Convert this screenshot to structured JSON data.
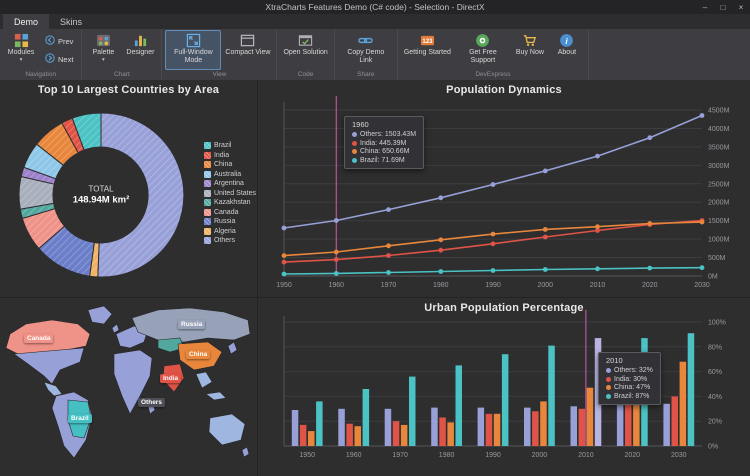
{
  "window": {
    "title": "XtraCharts Features Demo (C# code) - Selection - DirectX",
    "controls": [
      {
        "name": "minimize-button",
        "glyph": "–"
      },
      {
        "name": "maximize-button",
        "glyph": "□"
      },
      {
        "name": "close-button",
        "glyph": "×"
      }
    ]
  },
  "tabs": [
    {
      "label": "Demo",
      "active": true
    },
    {
      "label": "Skins",
      "active": false
    }
  ],
  "ribbon": {
    "groups": [
      {
        "name": "Navigation",
        "items": [
          {
            "kind": "big",
            "label": "Modules",
            "icon": "modules-icon",
            "caret": true
          },
          {
            "kind": "stack",
            "items": [
              {
                "label": "Prev",
                "icon": "prev-icon"
              },
              {
                "label": "Next",
                "icon": "next-icon"
              }
            ]
          }
        ]
      },
      {
        "name": "Chart",
        "items": [
          {
            "kind": "big",
            "label": "Palette",
            "icon": "palette-icon",
            "caret": true
          },
          {
            "kind": "big",
            "label": "Designer",
            "icon": "designer-icon"
          }
        ]
      },
      {
        "name": "View",
        "items": [
          {
            "kind": "big",
            "label": "Full-Window Mode",
            "icon": "full-window-icon",
            "selected": true
          },
          {
            "kind": "big",
            "label": "Compact View",
            "icon": "compact-view-icon"
          }
        ]
      },
      {
        "name": "Code",
        "items": [
          {
            "kind": "big",
            "label": "Open Solution",
            "icon": "open-solution-icon"
          }
        ]
      },
      {
        "name": "Share",
        "items": [
          {
            "kind": "big",
            "label": "Copy Demo Link",
            "icon": "copy-link-icon"
          }
        ]
      },
      {
        "name": "DevExpress",
        "items": [
          {
            "kind": "big",
            "label": "Getting Started",
            "icon": "getting-started-icon"
          },
          {
            "kind": "big",
            "label": "Get Free Support",
            "icon": "support-icon"
          },
          {
            "kind": "big",
            "label": "Buy Now",
            "icon": "buy-now-icon"
          },
          {
            "kind": "big",
            "label": "About",
            "icon": "about-icon"
          }
        ]
      }
    ]
  },
  "chart_data": [
    {
      "id": "area-donut",
      "type": "pie",
      "title": "Top 10 Largest Countries by Area",
      "center_label": {
        "line1": "TOTAL",
        "line2": "148.94M km²"
      },
      "unit": "M km²",
      "slices": [
        {
          "name": "Brazil",
          "value": 8.51,
          "color": "#4bc2c4"
        },
        {
          "name": "India",
          "value": 3.29,
          "color": "#e05347"
        },
        {
          "name": "China",
          "value": 9.6,
          "color": "#e8873c"
        },
        {
          "name": "Australia",
          "value": 7.69,
          "color": "#8fc7e8"
        },
        {
          "name": "Argentina",
          "value": 2.78,
          "color": "#9b82cc"
        },
        {
          "name": "United States",
          "value": 9.52,
          "color": "#a7aebc"
        },
        {
          "name": "Kazakhstan",
          "value": 2.72,
          "color": "#52a89e"
        },
        {
          "name": "Canada",
          "value": 9.98,
          "color": "#ef9288"
        },
        {
          "name": "Russia",
          "value": 17.1,
          "color": "#6b7ec9"
        },
        {
          "name": "Algeria",
          "value": 2.38,
          "color": "#f0b264"
        },
        {
          "name": "Others",
          "value": 75.37,
          "color": "#98a0d8"
        }
      ]
    },
    {
      "id": "population",
      "type": "line",
      "title": "Population Dynamics",
      "x": [
        1950,
        1960,
        1970,
        1980,
        1990,
        2000,
        2010,
        2020,
        2030
      ],
      "ylim": [
        0,
        4500
      ],
      "ytick_step": 500,
      "ytick_suffix": "M",
      "series": [
        {
          "name": "Others",
          "color": "#98a0d8",
          "values": [
            1300,
            1503.43,
            1800,
            2120,
            2480,
            2850,
            3250,
            3750,
            4350
          ]
        },
        {
          "name": "India",
          "color": "#e05347",
          "values": [
            376,
            445.39,
            555,
            699,
            873,
            1057,
            1234,
            1396,
            1504
          ]
        },
        {
          "name": "China",
          "color": "#e8873c",
          "values": [
            554,
            650.66,
            820,
            981,
            1135,
            1262,
            1337,
            1424,
            1460
          ]
        },
        {
          "name": "Brazil",
          "color": "#4bc2c4",
          "values": [
            54,
            71.69,
            96,
            121,
            149,
            175,
            196,
            214,
            225
          ]
        }
      ],
      "crosshair_x": 1960,
      "crosshair_color": "#d45cb1",
      "tooltip": {
        "header": "1960",
        "rows": [
          {
            "label": "Others",
            "value": "1503.43M",
            "color": "#98a0d8"
          },
          {
            "label": "India",
            "value": "445.39M",
            "color": "#e05347"
          },
          {
            "label": "China",
            "value": "650.66M",
            "color": "#e8873c"
          },
          {
            "label": "Brazil",
            "value": "71.69M",
            "color": "#4bc2c4"
          }
        ]
      }
    },
    {
      "id": "world-map",
      "type": "map",
      "regions": [
        {
          "name": "Canada",
          "color": "#ef9288"
        },
        {
          "name": "Russia",
          "color": "#97a2b8"
        },
        {
          "name": "China",
          "color": "#e8873c"
        },
        {
          "name": "India",
          "color": "#e05347"
        },
        {
          "name": "Others",
          "color": "#4e4e56"
        },
        {
          "name": "Brazil",
          "color": "#45bfc1"
        }
      ]
    },
    {
      "id": "urban",
      "type": "bar",
      "title": "Urban Population Percentage",
      "x": [
        1950,
        1960,
        1970,
        1980,
        1990,
        2000,
        2010,
        2020,
        2030
      ],
      "ylim": [
        0,
        100
      ],
      "ytick_step": 20,
      "ytick_suffix": "%",
      "series": [
        {
          "name": "Others",
          "color": "#98a0d8",
          "values": [
            29,
            30,
            30,
            31,
            31,
            31,
            32,
            33,
            34
          ]
        },
        {
          "name": "India",
          "color": "#e05347",
          "values": [
            17,
            18,
            20,
            23,
            26,
            28,
            30,
            35,
            40
          ]
        },
        {
          "name": "China",
          "color": "#e8873c",
          "values": [
            12,
            16,
            17,
            19,
            26,
            36,
            47,
            61,
            68
          ]
        },
        {
          "name": "Brazil",
          "color": "#4bc2c4",
          "values": [
            36,
            46,
            56,
            65,
            74,
            81,
            87,
            87,
            91
          ]
        }
      ],
      "selected_bar": {
        "series": "Brazil",
        "x": 2010,
        "highlight_color": "#b9b3e3"
      },
      "crosshair_x": 2010,
      "crosshair_color": "#d45cb1",
      "tooltip": {
        "header": "2010",
        "rows": [
          {
            "label": "Others",
            "value": "32%",
            "color": "#98a0d8"
          },
          {
            "label": "India",
            "value": "30%",
            "color": "#e05347"
          },
          {
            "label": "China",
            "value": "47%",
            "color": "#e8873c"
          },
          {
            "label": "Brazil",
            "value": "87%",
            "color": "#4bc2c4"
          }
        ]
      }
    }
  ]
}
